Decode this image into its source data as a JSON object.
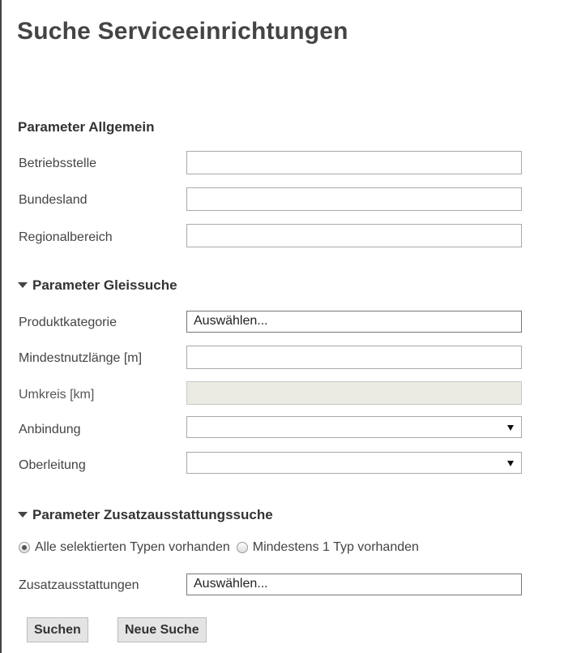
{
  "page": {
    "title": "Suche Serviceeinrichtungen"
  },
  "allgemein": {
    "heading": "Parameter Allgemein",
    "betriebsstelle": {
      "label": "Betriebsstelle",
      "value": ""
    },
    "bundesland": {
      "label": "Bundesland",
      "value": ""
    },
    "regionalbereich": {
      "label": "Regionalbereich",
      "value": ""
    }
  },
  "gleissuche": {
    "heading": "Parameter Gleissuche",
    "produktkategorie": {
      "label": "Produktkategorie",
      "value": "Auswählen..."
    },
    "mindestnutzlaenge": {
      "label": "Mindestnutzlänge [m]",
      "value": ""
    },
    "umkreis": {
      "label": "Umkreis [km]",
      "value": ""
    },
    "anbindung": {
      "label": "Anbindung",
      "value": ""
    },
    "oberleitung": {
      "label": "Oberleitung",
      "value": ""
    }
  },
  "zusatz": {
    "heading": "Parameter Zusatzausstattungssuche",
    "radio_all": {
      "label": "Alle selektierten Typen vorhanden",
      "checked": true
    },
    "radio_min": {
      "label": "Mindestens 1 Typ vorhanden",
      "checked": false
    },
    "zusatzausstattungen": {
      "label": "Zusatzausstattungen",
      "value": "Auswählen..."
    }
  },
  "buttons": {
    "search": "Suchen",
    "new_search": "Neue Suche"
  }
}
